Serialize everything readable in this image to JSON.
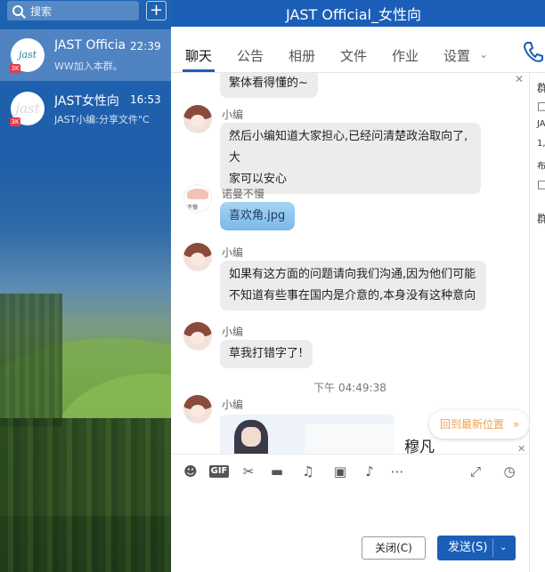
{
  "sidebar": {
    "search_placeholder": "搜索",
    "add_label": "+",
    "conversations": [
      {
        "avatar_text": "jast",
        "badge": "3K",
        "name": "JAST Official",
        "time": "22:39",
        "preview": "WW加入本群。"
      },
      {
        "avatar_text": "jast",
        "badge": "3K",
        "name": "JAST女性向",
        "time": "16:53",
        "preview": "JAST小编:分享文件\"C"
      }
    ]
  },
  "window": {
    "title": "JAST Official_女性向"
  },
  "tabs": {
    "items": [
      "聊天",
      "公告",
      "相册",
      "文件",
      "作业",
      "设置"
    ],
    "settings_chevron": "⌄"
  },
  "chat": {
    "messages": [
      {
        "sender": "",
        "text": "繁体看得懂的~"
      },
      {
        "sender": "小编",
        "lines": [
          "然后小编知道大家担心,已经问清楚政治取向了,大",
          "家可以安心"
        ]
      },
      {
        "sender": "诺曼不慢",
        "text": "喜欢角.jpg",
        "avatar_label": "不慢"
      },
      {
        "sender": "小编",
        "lines": [
          "如果有这方面的问题请向我们沟通,因为他们可能",
          "不知道有些事在国内是介意的,本身没有这种意向"
        ]
      },
      {
        "sender": "小编",
        "text": "草我打错字了!"
      },
      {
        "sender": "小编",
        "image_caption": "穆凡"
      }
    ],
    "time_divider": "下午 04:49:38",
    "jump_latest": "回到最新位置",
    "jump_chevron": "»"
  },
  "toolbar": {
    "icons": [
      "emoji-icon",
      "gif-icon",
      "scissors-icon",
      "folder-icon",
      "voice-icon",
      "image-icon",
      "bell-icon",
      "more-icon",
      "expand-icon",
      "history-icon"
    ],
    "gif_label": "GIF"
  },
  "actions": {
    "close_label": "关闭(C)",
    "send_label": "发送(S)",
    "send_dropdown": "⌄"
  },
  "right_panel": {
    "chars": [
      "群",
      "□",
      "JA",
      "1,",
      "布",
      "□",
      "群"
    ]
  }
}
